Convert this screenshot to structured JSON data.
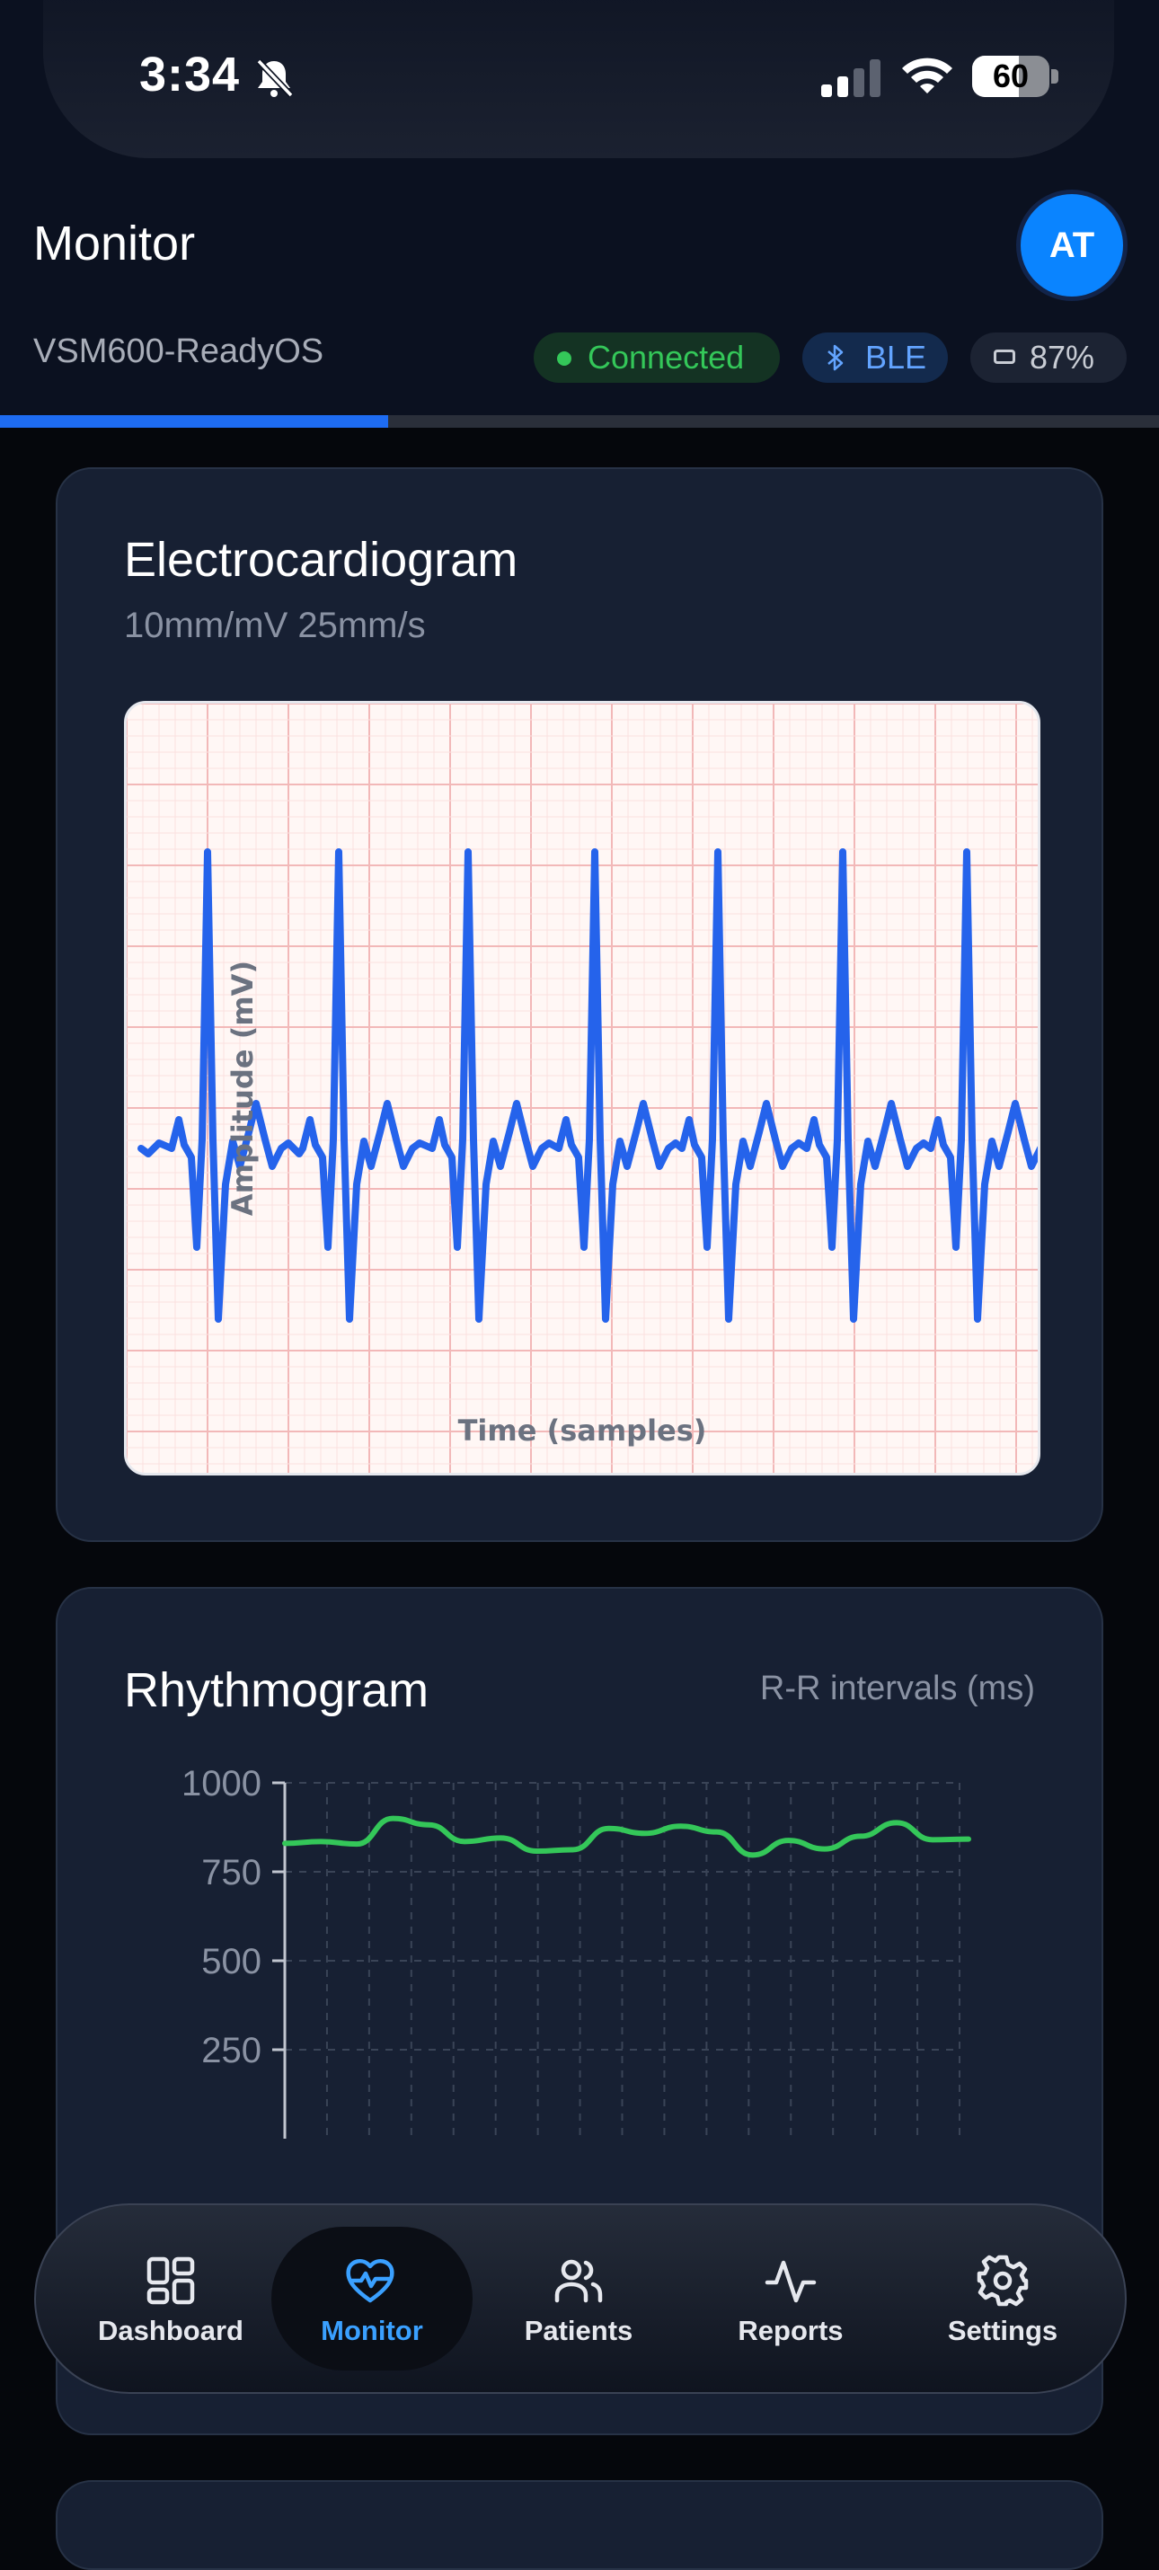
{
  "status_bar": {
    "time": "3:34",
    "battery": "60"
  },
  "header": {
    "title": "Monitor",
    "avatar_initials": "AT",
    "device_name": "VSM600-ReadyOS",
    "connection_status": "Connected",
    "transport": "BLE",
    "device_battery": "87%",
    "sync_progress": 0.335
  },
  "ecg_card": {
    "title": "Electrocardiogram",
    "subtitle": "10mm/mV 25mm/s",
    "chart_data": {
      "type": "line",
      "xlabel": "Time (samples)",
      "ylabel": "Amplitude (mV)",
      "grid": true,
      "beat_count": 7,
      "series": [
        {
          "color": "#2563eb"
        }
      ]
    }
  },
  "rhythm_card": {
    "title": "Rhythmogram",
    "subtitle": "R-R intervals (ms)",
    "chart_data": {
      "type": "line",
      "ylim": [
        0,
        1000
      ],
      "yticks": [
        "1000",
        "750",
        "500",
        "250"
      ],
      "grid": true,
      "series": [
        {
          "color": "#34c759",
          "values": [
            830,
            835,
            828,
            900,
            882,
            835,
            845,
            808,
            812,
            872,
            858,
            878,
            862,
            797,
            838,
            814,
            850,
            888,
            840,
            842
          ]
        }
      ]
    }
  },
  "tabbar": {
    "tabs": [
      {
        "label": "Dashboard",
        "icon": "dashboard-icon"
      },
      {
        "label": "Monitor",
        "icon": "heart-pulse-icon"
      },
      {
        "label": "Patients",
        "icon": "users-icon"
      },
      {
        "label": "Reports",
        "icon": "activity-icon"
      },
      {
        "label": "Settings",
        "icon": "gear-icon"
      }
    ],
    "active": 1
  }
}
